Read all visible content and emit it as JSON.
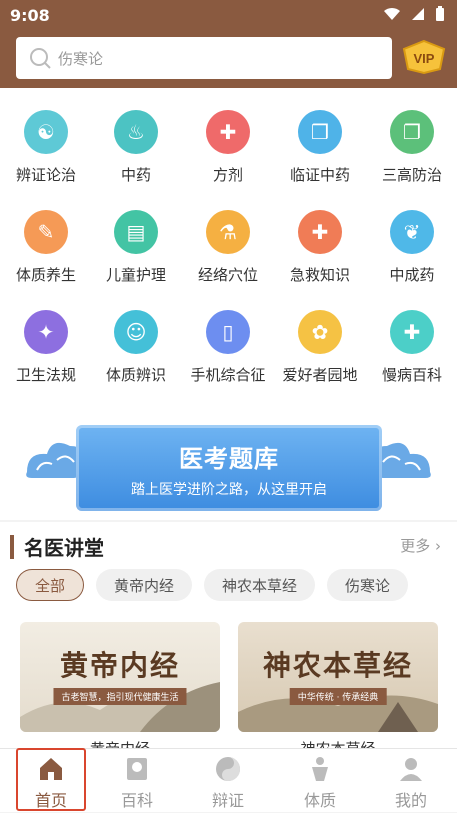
{
  "status": {
    "time": "9:08"
  },
  "search": {
    "placeholder": "伤寒论"
  },
  "vip": {
    "label": "VIP"
  },
  "grid": [
    {
      "label": "辨证论治",
      "icon": "yin-yang-icon",
      "color": "#5ec9d6"
    },
    {
      "label": "中药",
      "icon": "herb-pot-icon",
      "color": "#4cc3c3"
    },
    {
      "label": "方剂",
      "icon": "prescription-jar-icon",
      "color": "#ef6a6a"
    },
    {
      "label": "临证中药",
      "icon": "gift-box-icon",
      "color": "#4fb3e8"
    },
    {
      "label": "三高防治",
      "icon": "book-icon",
      "color": "#5cc07a"
    },
    {
      "label": "体质养生",
      "icon": "notepad-icon",
      "color": "#f59a56"
    },
    {
      "label": "儿童护理",
      "icon": "clipboard-icon",
      "color": "#43c4a4"
    },
    {
      "label": "经络穴位",
      "icon": "medicine-bottle-icon",
      "color": "#f5b042"
    },
    {
      "label": "急救知识",
      "icon": "first-aid-icon",
      "color": "#f07c56"
    },
    {
      "label": "中成药",
      "icon": "scan-leaf-icon",
      "color": "#4fb8e8"
    },
    {
      "label": "卫生法规",
      "icon": "shield-icon",
      "color": "#8d6fe0"
    },
    {
      "label": "体质辨识",
      "icon": "body-scan-icon",
      "color": "#44c0d8"
    },
    {
      "label": "手机综合征",
      "icon": "phone-icon",
      "color": "#6d8ef0"
    },
    {
      "label": "爱好者园地",
      "icon": "flower-icon",
      "color": "#f5c244"
    },
    {
      "label": "慢病百科",
      "icon": "medical-cross-icon",
      "color": "#4ccfc8"
    }
  ],
  "banner": {
    "title": "医考题库",
    "subtitle": "踏上医学进阶之路，从这里开启"
  },
  "section": {
    "title": "名医讲堂",
    "more": "更多"
  },
  "tabs": [
    "全部",
    "黄帝内经",
    "神农本草经",
    "伤寒论"
  ],
  "cards": [
    {
      "cover_title": "黄帝内经",
      "cover_sub": "古老智慧，指引现代健康生活",
      "name": "黄帝内经"
    },
    {
      "cover_title": "神农本草经",
      "cover_sub": "中华传统 · 传承经典",
      "name": "神农本草经"
    }
  ],
  "nav": [
    {
      "label": "首页",
      "icon": "home-icon"
    },
    {
      "label": "百科",
      "icon": "encyclopedia-icon"
    },
    {
      "label": "辩证",
      "icon": "yin-yang-icon"
    },
    {
      "label": "体质",
      "icon": "body-icon"
    },
    {
      "label": "我的",
      "icon": "user-icon"
    }
  ],
  "colors": {
    "brand": "#8a5a40",
    "active_highlight": "#d9462e"
  }
}
